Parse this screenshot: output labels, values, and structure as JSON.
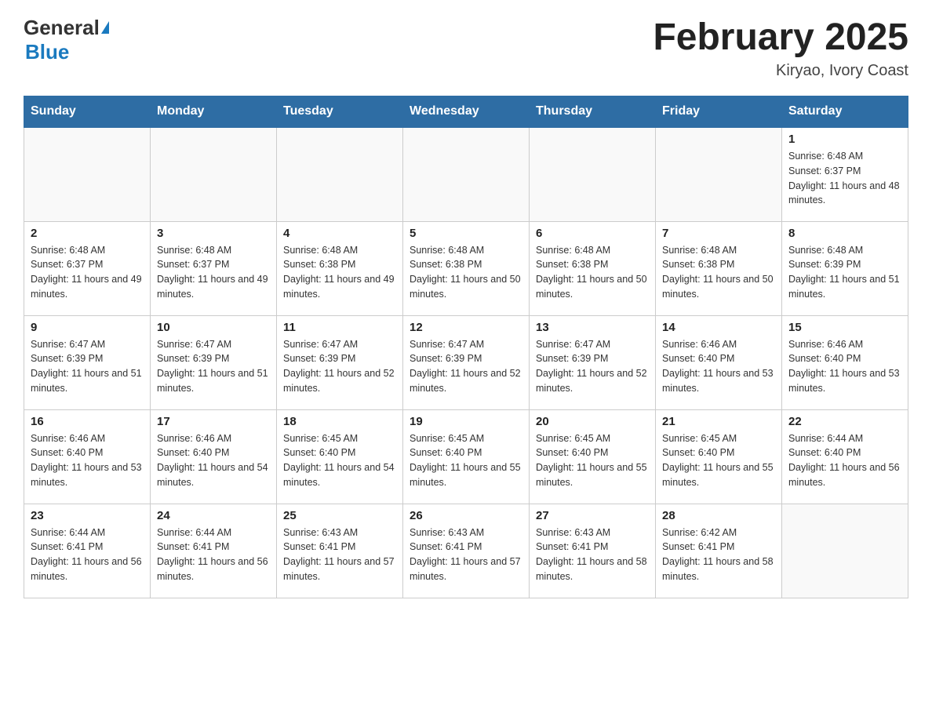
{
  "header": {
    "logo_general": "General",
    "logo_blue": "Blue",
    "title": "February 2025",
    "location": "Kiryao, Ivory Coast"
  },
  "days_of_week": [
    "Sunday",
    "Monday",
    "Tuesday",
    "Wednesday",
    "Thursday",
    "Friday",
    "Saturday"
  ],
  "weeks": [
    {
      "days": [
        {
          "num": "",
          "info": ""
        },
        {
          "num": "",
          "info": ""
        },
        {
          "num": "",
          "info": ""
        },
        {
          "num": "",
          "info": ""
        },
        {
          "num": "",
          "info": ""
        },
        {
          "num": "",
          "info": ""
        },
        {
          "num": "1",
          "info": "Sunrise: 6:48 AM\nSunset: 6:37 PM\nDaylight: 11 hours and 48 minutes."
        }
      ]
    },
    {
      "days": [
        {
          "num": "2",
          "info": "Sunrise: 6:48 AM\nSunset: 6:37 PM\nDaylight: 11 hours and 49 minutes."
        },
        {
          "num": "3",
          "info": "Sunrise: 6:48 AM\nSunset: 6:37 PM\nDaylight: 11 hours and 49 minutes."
        },
        {
          "num": "4",
          "info": "Sunrise: 6:48 AM\nSunset: 6:38 PM\nDaylight: 11 hours and 49 minutes."
        },
        {
          "num": "5",
          "info": "Sunrise: 6:48 AM\nSunset: 6:38 PM\nDaylight: 11 hours and 50 minutes."
        },
        {
          "num": "6",
          "info": "Sunrise: 6:48 AM\nSunset: 6:38 PM\nDaylight: 11 hours and 50 minutes."
        },
        {
          "num": "7",
          "info": "Sunrise: 6:48 AM\nSunset: 6:38 PM\nDaylight: 11 hours and 50 minutes."
        },
        {
          "num": "8",
          "info": "Sunrise: 6:48 AM\nSunset: 6:39 PM\nDaylight: 11 hours and 51 minutes."
        }
      ]
    },
    {
      "days": [
        {
          "num": "9",
          "info": "Sunrise: 6:47 AM\nSunset: 6:39 PM\nDaylight: 11 hours and 51 minutes."
        },
        {
          "num": "10",
          "info": "Sunrise: 6:47 AM\nSunset: 6:39 PM\nDaylight: 11 hours and 51 minutes."
        },
        {
          "num": "11",
          "info": "Sunrise: 6:47 AM\nSunset: 6:39 PM\nDaylight: 11 hours and 52 minutes."
        },
        {
          "num": "12",
          "info": "Sunrise: 6:47 AM\nSunset: 6:39 PM\nDaylight: 11 hours and 52 minutes."
        },
        {
          "num": "13",
          "info": "Sunrise: 6:47 AM\nSunset: 6:39 PM\nDaylight: 11 hours and 52 minutes."
        },
        {
          "num": "14",
          "info": "Sunrise: 6:46 AM\nSunset: 6:40 PM\nDaylight: 11 hours and 53 minutes."
        },
        {
          "num": "15",
          "info": "Sunrise: 6:46 AM\nSunset: 6:40 PM\nDaylight: 11 hours and 53 minutes."
        }
      ]
    },
    {
      "days": [
        {
          "num": "16",
          "info": "Sunrise: 6:46 AM\nSunset: 6:40 PM\nDaylight: 11 hours and 53 minutes."
        },
        {
          "num": "17",
          "info": "Sunrise: 6:46 AM\nSunset: 6:40 PM\nDaylight: 11 hours and 54 minutes."
        },
        {
          "num": "18",
          "info": "Sunrise: 6:45 AM\nSunset: 6:40 PM\nDaylight: 11 hours and 54 minutes."
        },
        {
          "num": "19",
          "info": "Sunrise: 6:45 AM\nSunset: 6:40 PM\nDaylight: 11 hours and 55 minutes."
        },
        {
          "num": "20",
          "info": "Sunrise: 6:45 AM\nSunset: 6:40 PM\nDaylight: 11 hours and 55 minutes."
        },
        {
          "num": "21",
          "info": "Sunrise: 6:45 AM\nSunset: 6:40 PM\nDaylight: 11 hours and 55 minutes."
        },
        {
          "num": "22",
          "info": "Sunrise: 6:44 AM\nSunset: 6:40 PM\nDaylight: 11 hours and 56 minutes."
        }
      ]
    },
    {
      "days": [
        {
          "num": "23",
          "info": "Sunrise: 6:44 AM\nSunset: 6:41 PM\nDaylight: 11 hours and 56 minutes."
        },
        {
          "num": "24",
          "info": "Sunrise: 6:44 AM\nSunset: 6:41 PM\nDaylight: 11 hours and 56 minutes."
        },
        {
          "num": "25",
          "info": "Sunrise: 6:43 AM\nSunset: 6:41 PM\nDaylight: 11 hours and 57 minutes."
        },
        {
          "num": "26",
          "info": "Sunrise: 6:43 AM\nSunset: 6:41 PM\nDaylight: 11 hours and 57 minutes."
        },
        {
          "num": "27",
          "info": "Sunrise: 6:43 AM\nSunset: 6:41 PM\nDaylight: 11 hours and 58 minutes."
        },
        {
          "num": "28",
          "info": "Sunrise: 6:42 AM\nSunset: 6:41 PM\nDaylight: 11 hours and 58 minutes."
        },
        {
          "num": "",
          "info": ""
        }
      ]
    }
  ]
}
